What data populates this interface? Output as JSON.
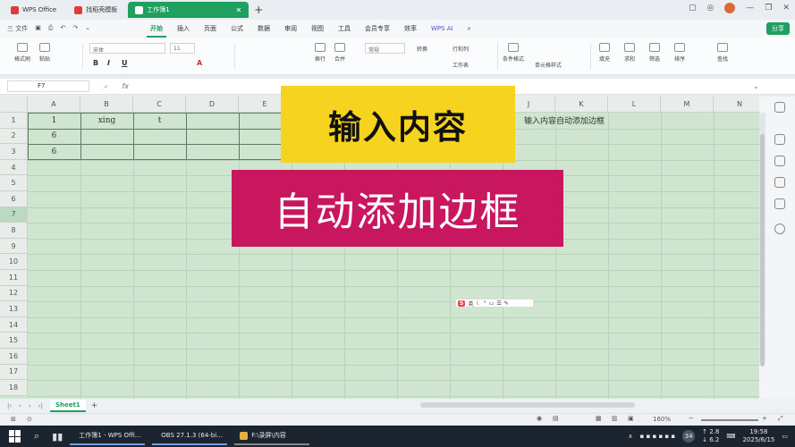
{
  "titlebar": {
    "tabs": [
      {
        "label": "WPS Office",
        "color": "#e03b3b"
      },
      {
        "label": "找稻壳模板",
        "color": "#e03b3b"
      },
      {
        "label": "工作簿1",
        "color": "#1fa060"
      }
    ],
    "new_tab": "+"
  },
  "menubar": {
    "quick_file": "三 文件",
    "items": [
      "开始",
      "插入",
      "页面",
      "公式",
      "数据",
      "审阅",
      "视图",
      "工具",
      "会员专享",
      "效率",
      "WPS AI"
    ],
    "active": "开始",
    "share": "分享"
  },
  "ribbon": {
    "font_name": "宋体",
    "font_size": "11",
    "number_format": "常规",
    "groups": [
      {
        "label": "格式刷"
      },
      {
        "label": "粘贴"
      },
      {
        "label": "换行"
      },
      {
        "label": "合并"
      },
      {
        "label": "转换"
      },
      {
        "label": "行和列"
      },
      {
        "label": "工作表"
      },
      {
        "label": "条件格式"
      },
      {
        "label": "单元格样式"
      },
      {
        "label": "求和"
      },
      {
        "label": "筛选"
      },
      {
        "label": "排序"
      },
      {
        "label": "填充"
      },
      {
        "label": "查找"
      }
    ],
    "format_buttons": [
      "B",
      "I",
      "U",
      "A"
    ]
  },
  "formula_bar": {
    "cell_ref": "F7",
    "fx": "fx",
    "value": ""
  },
  "grid": {
    "columns": [
      "A",
      "B",
      "C",
      "D",
      "E",
      "F",
      "G",
      "H",
      "I",
      "J",
      "K",
      "L",
      "M",
      "N"
    ],
    "rows": [
      "1",
      "2",
      "3",
      "4",
      "5",
      "6",
      "7",
      "8",
      "9",
      "10",
      "11",
      "12",
      "13",
      "14",
      "15",
      "16",
      "17",
      "18"
    ],
    "selected_row": "7",
    "cells": {
      "A1": "1",
      "B1": "xing",
      "C1": "t",
      "A2": "6",
      "A3": "6"
    },
    "overflow_text": "输入内容自动添加边框"
  },
  "overlays": {
    "banner_top": "输入内容",
    "banner_bottom": "自动添加边框",
    "top_color": "#f6d31f",
    "bottom_color": "#c8175f"
  },
  "ime_toolbar": {
    "logo": "S",
    "label": "英"
  },
  "sheets": {
    "tabs": [
      "Sheet1"
    ],
    "add": "+"
  },
  "status": {
    "zoom": "160%"
  },
  "taskbar": {
    "apps": [
      {
        "label": "工作簿1 - WPS Offi...",
        "color": "#d6303a"
      },
      {
        "label": "OBS 27.1.3 (64-bi...",
        "color": "#555"
      },
      {
        "label": "F:\\录屏\\内容",
        "color": "#e6b03a"
      }
    ],
    "notification_count": "34",
    "network_up": "↑ 2.8",
    "network_down": "↓ 6.2",
    "time": "19:58",
    "date": "2025/6/15"
  },
  "colors": {
    "accent": "#1fa060",
    "grid_bg": "#cfe5cf"
  }
}
